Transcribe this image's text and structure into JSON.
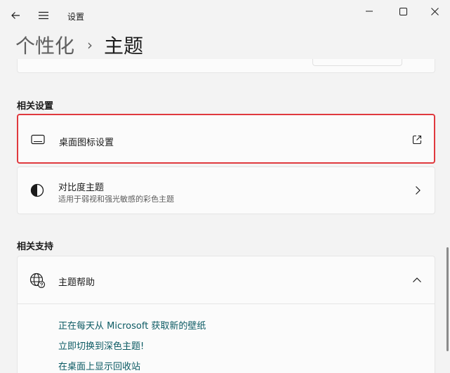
{
  "window": {
    "title": "设置"
  },
  "breadcrumb": {
    "parent": "个性化",
    "separator": "›",
    "current": "主题"
  },
  "related_settings": {
    "title": "相关设置",
    "items": [
      {
        "label": "桌面图标设置",
        "icon": "monitor-icon",
        "trailing_icon": "external-link-icon",
        "highlighted": true
      },
      {
        "label": "对比度主题",
        "sublabel": "适用于弱视和强光敏感的彩色主题",
        "icon": "contrast-icon",
        "trailing_icon": "chevron-right-icon"
      }
    ]
  },
  "related_support": {
    "title": "相关支持",
    "help": {
      "label": "主题帮助",
      "icon": "globe-help-icon",
      "trailing_icon": "chevron-up-icon",
      "expanded": true,
      "links": [
        "正在每天从 Microsoft 获取新的壁纸",
        "立即切换到深色主题!",
        "在桌面上显示回收站"
      ]
    }
  },
  "colors": {
    "highlight_border": "#e0393e",
    "link": "#0b5a63",
    "background": "#f3f3f3",
    "card": "#fbfbfb"
  }
}
